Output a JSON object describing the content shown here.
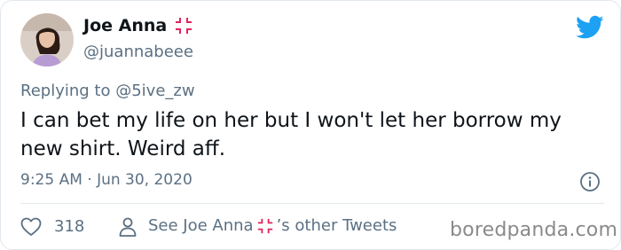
{
  "author": {
    "name": "Joe Anna",
    "handle": "@juannabeee",
    "badge_icon": "anger-symbol-icon"
  },
  "reply": {
    "prefix": "Replying to",
    "to": "@5ive_zw"
  },
  "tweet": {
    "text": "I can bet my life on her but I won't let her borrow my new shirt. Weird aff."
  },
  "meta": {
    "timestamp": "9:25 AM · Jun 30, 2020"
  },
  "actions": {
    "likes": "318",
    "see_prefix": "See Joe Anna",
    "see_suffix": "’s other Tweets"
  },
  "watermark": "boredpanda.com",
  "colors": {
    "twitter_blue": "#1da1f2",
    "secondary_text": "#5b7083",
    "anger": "#e0245e"
  }
}
